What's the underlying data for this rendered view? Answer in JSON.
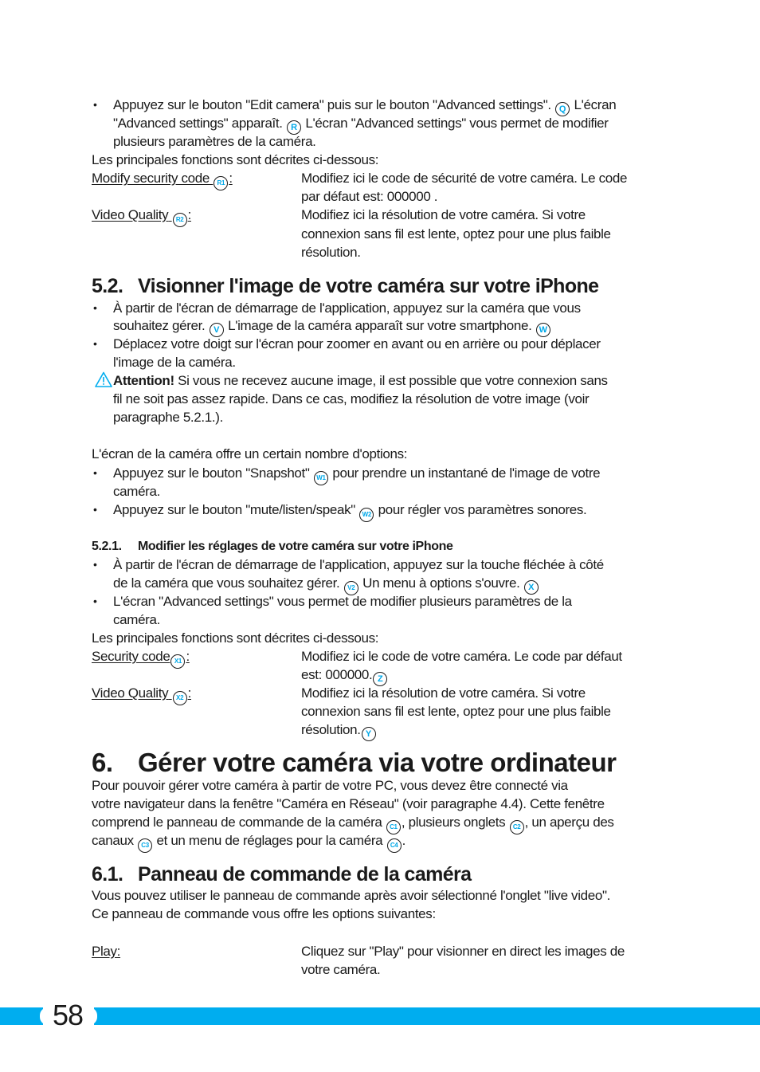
{
  "accent_color": "#00adef",
  "section_5_1_tail": {
    "bullet1": {
      "line1_pre": "Appuyez sur le bouton \"Edit camera\" puis sur le bouton \"Advanced settings\".",
      "badge_q": "Q",
      "line1_post": "L'écran",
      "line2_pre": "\"Advanced settings\" apparaît.",
      "badge_r": "R",
      "line2_post": "L'écran \"Advanced settings\" vous permet de modifier",
      "line3": "plusieurs paramètres de la caméra."
    },
    "intro": "Les principales fonctions sont décrites ci-dessous:",
    "definitions": [
      {
        "term": "Modify security code",
        "badge": "R1",
        "lines": [
          "Modifiez ici le code de sécurité de votre caméra. Le code",
          "par défaut est: 000000 ."
        ]
      },
      {
        "term": "Video Quality",
        "badge": "R2",
        "lines": [
          "Modifiez ici la résolution de votre caméra. Si votre",
          "connexion sans fil est lente, optez pour une plus faible",
          "résolution."
        ]
      }
    ]
  },
  "section_5_2": {
    "number": "5.2.",
    "title": "Visionner l'image de votre caméra sur votre iPhone",
    "bullet1": {
      "line1": "À partir de l'écran de démarrage de l'application, appuyez sur la caméra que vous",
      "line2_pre": "souhaitez gérer.",
      "badge_v": "V",
      "line2_mid": "L'image de la caméra apparaît sur votre smartphone.",
      "badge_w": "W"
    },
    "bullet2": {
      "line1": "Déplacez votre doigt sur l'écran pour zoomer en avant ou en arrière ou pour déplacer",
      "line2": "l'image de la caméra."
    },
    "attention": {
      "label": "Attention!",
      "line1": "Si vous ne recevez aucune image, il est possible que votre connexion sans",
      "line2": "fil ne soit pas assez rapide. Dans ce cas, modifiez la résolution de votre image (voir",
      "line3": "paragraphe 5.2.1.)."
    },
    "options_intro": "L'écran de la caméra offre un certain nombre d'options:",
    "bullet3": {
      "line1_pre": "Appuyez sur le bouton \"Snapshot\"",
      "badge": "W1",
      "line1_post": "pour prendre un instantané de l'image de votre",
      "line2": "caméra."
    },
    "bullet4": {
      "pre": "Appuyez sur le bouton \"mute/listen/speak\"",
      "badge": "W2",
      "post": "pour régler vos paramètres sonores."
    }
  },
  "section_5_2_1": {
    "number": "5.2.1.",
    "title": "Modifier les réglages de votre caméra sur votre iPhone",
    "bullet1": {
      "line1": "À partir de l'écran de démarrage de l'application, appuyez sur la touche fléchée à côté",
      "line2_pre": "de la caméra que vous souhaitez gérer.",
      "badge_v2": "V2",
      "line2_mid": "Un menu à options s'ouvre.",
      "badge_x": "X"
    },
    "bullet2": {
      "line1": "L'écran \"Advanced settings\" vous permet de modifier plusieurs paramètres de la",
      "line2": "caméra."
    },
    "intro": "Les principales fonctions sont décrites ci-dessous:",
    "definitions": [
      {
        "term": "Security code",
        "badge": "X1",
        "line1": "Modifiez ici le code de votre caméra. Le code par défaut",
        "line2": "est: 000000.",
        "end_badge": "Z"
      },
      {
        "term": "Video Quality",
        "badge": "X2",
        "line1": "Modifiez ici la résolution de votre caméra. Si votre",
        "line2": "connexion sans fil est lente, optez pour une plus faible",
        "line3": "résolution.",
        "end_badge": "Y"
      }
    ]
  },
  "section_6": {
    "number": "6.",
    "title": "Gérer votre caméra via votre ordinateur",
    "para": {
      "line1": "Pour pouvoir gérer votre caméra à partir de votre PC, vous devez être connecté via",
      "line2": "votre navigateur dans la fenêtre \"Caméra en Réseau\" (voir paragraphe 4.4). Cette fenêtre",
      "line3_a": "comprend le panneau de commande de la caméra",
      "badge_c1": "C1",
      "line3_b": ", plusieurs onglets",
      "badge_c2": "C2",
      "line3_c": ", un aperçu des",
      "line4_a": "canaux",
      "badge_c3": "C3",
      "line4_b": "et un menu de réglages pour la caméra",
      "badge_c4": "C4",
      "line4_c": "."
    }
  },
  "section_6_1": {
    "number": "6.1.",
    "title": "Panneau de commande de la caméra",
    "line1": "Vous pouvez utiliser le panneau de commande après avoir sélectionné l'onglet \"live video\".",
    "line2": "Ce panneau de commande vous offre les options suivantes:",
    "definitions": [
      {
        "term": "Play:",
        "line1": "Cliquez sur \"Play\" pour visionner en direct les images de",
        "line2": "votre caméra."
      }
    ]
  },
  "footer": {
    "page_number": "58"
  }
}
